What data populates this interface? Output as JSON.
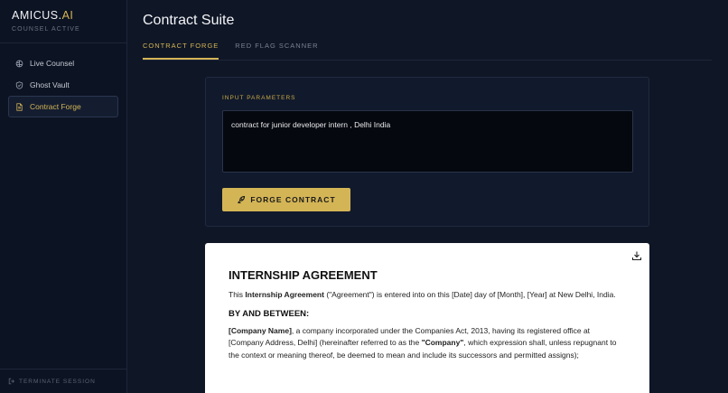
{
  "brand": {
    "name_main": "AMICUS.",
    "name_accent": "AI",
    "status": "COUNSEL ACTIVE",
    "accent_color": "#d4b556"
  },
  "nav": {
    "items": [
      {
        "label": "Live Counsel",
        "icon": "brain-icon"
      },
      {
        "label": "Ghost Vault",
        "icon": "shield-icon"
      },
      {
        "label": "Contract Forge",
        "icon": "document-icon",
        "active": true
      }
    ],
    "terminate": "TERMINATE SESSION"
  },
  "page": {
    "title": "Contract Suite"
  },
  "tabs": [
    {
      "label": "CONTRACT FORGE",
      "active": true
    },
    {
      "label": "RED FLAG SCANNER",
      "active": false
    }
  ],
  "input_panel": {
    "label": "INPUT PARAMETERS",
    "prompt_value": "contract for junior developer intern , Delhi India",
    "button_label": "FORGE CONTRACT"
  },
  "document": {
    "title": "INTERNSHIP AGREEMENT",
    "p1": {
      "pre": "This ",
      "bold": "Internship Agreement",
      "post": " (\"Agreement\") is entered into on this [Date] day of [Month], [Year] at New Delhi, India."
    },
    "section": "BY AND BETWEEN:",
    "p2": {
      "bold1": "[Company Name]",
      "mid1": ", a company incorporated under the Companies Act, 2013, having its registered office at [Company Address, Delhi] (hereinafter referred to as the ",
      "bold2": "\"Company\"",
      "mid2": ", which expression shall, unless repugnant to the context or meaning thereof, be deemed to mean and include its successors and permitted assigns);"
    }
  }
}
